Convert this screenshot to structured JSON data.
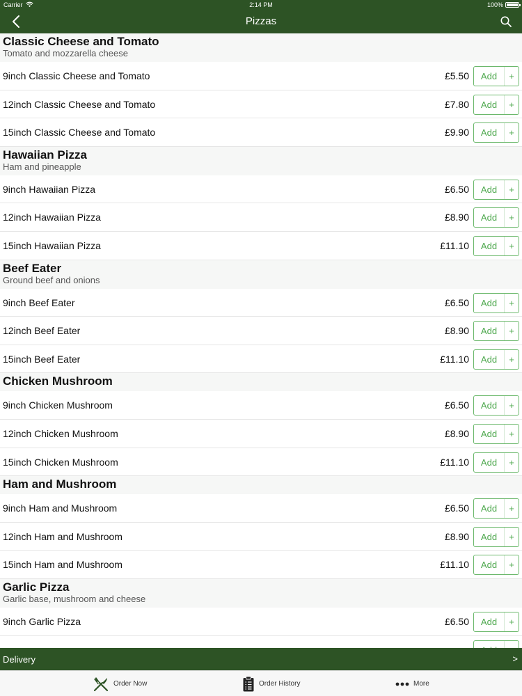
{
  "status_bar": {
    "carrier": "Carrier",
    "time": "2:14 PM",
    "battery": "100%"
  },
  "nav": {
    "title": "Pizzas",
    "back_icon": "chevron-left-icon",
    "search_icon": "search-icon"
  },
  "groups": [
    {
      "title": "Classic Cheese and Tomato",
      "description": "Tomato and mozzarella cheese",
      "items": [
        {
          "name": "9inch Classic Cheese and Tomato",
          "price": "£5.50"
        },
        {
          "name": "12inch Classic Cheese and Tomato",
          "price": "£7.80"
        },
        {
          "name": "15inch Classic Cheese and Tomato",
          "price": "£9.90"
        }
      ]
    },
    {
      "title": "Hawaiian Pizza",
      "description": "Ham and pineapple",
      "items": [
        {
          "name": "9inch Hawaiian Pizza",
          "price": "£6.50"
        },
        {
          "name": "12inch Hawaiian Pizza",
          "price": "£8.90"
        },
        {
          "name": "15inch Hawaiian Pizza",
          "price": "£11.10"
        }
      ]
    },
    {
      "title": "Beef Eater",
      "description": "Ground beef and onions",
      "items": [
        {
          "name": "9inch Beef Eater",
          "price": "£6.50"
        },
        {
          "name": "12inch Beef Eater",
          "price": "£8.90"
        },
        {
          "name": "15inch Beef Eater",
          "price": "£11.10"
        }
      ]
    },
    {
      "title": "Chicken  Mushroom",
      "description": "",
      "items": [
        {
          "name": "9inch Chicken  Mushroom",
          "price": "£6.50"
        },
        {
          "name": "12inch Chicken  Mushroom",
          "price": "£8.90"
        },
        {
          "name": "15inch Chicken  Mushroom",
          "price": "£11.10"
        }
      ]
    },
    {
      "title": "Ham and Mushroom",
      "description": "",
      "items": [
        {
          "name": "9inch Ham and Mushroom",
          "price": "£6.50"
        },
        {
          "name": "12inch Ham and Mushroom",
          "price": "£8.90"
        },
        {
          "name": "15inch Ham and Mushroom",
          "price": "£11.10"
        }
      ]
    },
    {
      "title": "Garlic Pizza",
      "description": "Garlic base, mushroom and cheese",
      "items": [
        {
          "name": "9inch Garlic Pizza",
          "price": "£6.50"
        },
        {
          "name": "",
          "price": ""
        }
      ]
    }
  ],
  "add_button": {
    "label": "Add",
    "plus": "+"
  },
  "delivery": {
    "label": "Delivery",
    "arrow": ">"
  },
  "tabs": [
    {
      "label": "Order Now",
      "icon": "fork-knife-icon"
    },
    {
      "label": "Order History",
      "icon": "clipboard-icon"
    },
    {
      "label": "More",
      "icon": "more-dots-icon"
    }
  ],
  "colors": {
    "brand": "#2d5325",
    "accent": "#4ea84e"
  }
}
